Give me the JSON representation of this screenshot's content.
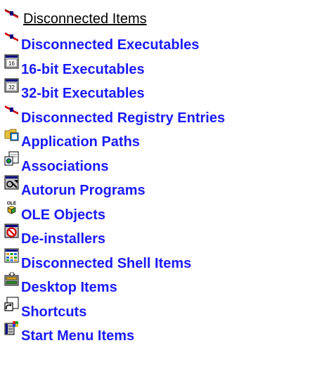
{
  "header": {
    "title": "Disconnected Items",
    "icon": "disconnected-plug-icon"
  },
  "items": [
    {
      "label": "Disconnected Executables",
      "icon": "disconnected-plug-icon"
    },
    {
      "label": "16-bit Executables",
      "icon": "16-bit-window-icon"
    },
    {
      "label": "32-bit Executables",
      "icon": "32-bit-window-icon"
    },
    {
      "label": "Disconnected Registry Entries",
      "icon": "disconnected-plug-icon"
    },
    {
      "label": "Application Paths",
      "icon": "application-folder-icon"
    },
    {
      "label": "Associations",
      "icon": "associations-document-icon"
    },
    {
      "label": "Autorun Programs",
      "icon": "autorun-icon"
    },
    {
      "label": "OLE Objects",
      "icon": "ole-cube-icon"
    },
    {
      "label": "De-installers",
      "icon": "deinstall-prohibited-icon"
    },
    {
      "label": "Disconnected Shell Items",
      "icon": "shell-grid-icon"
    },
    {
      "label": "Desktop Items",
      "icon": "desktop-items-icon"
    },
    {
      "label": "Shortcuts",
      "icon": "shortcut-arrow-icon"
    },
    {
      "label": "Start Menu Items",
      "icon": "start-menu-icon"
    }
  ],
  "colors": {
    "link": "#1a1aff",
    "header_text": "#000000",
    "background": "#ffffff"
  }
}
